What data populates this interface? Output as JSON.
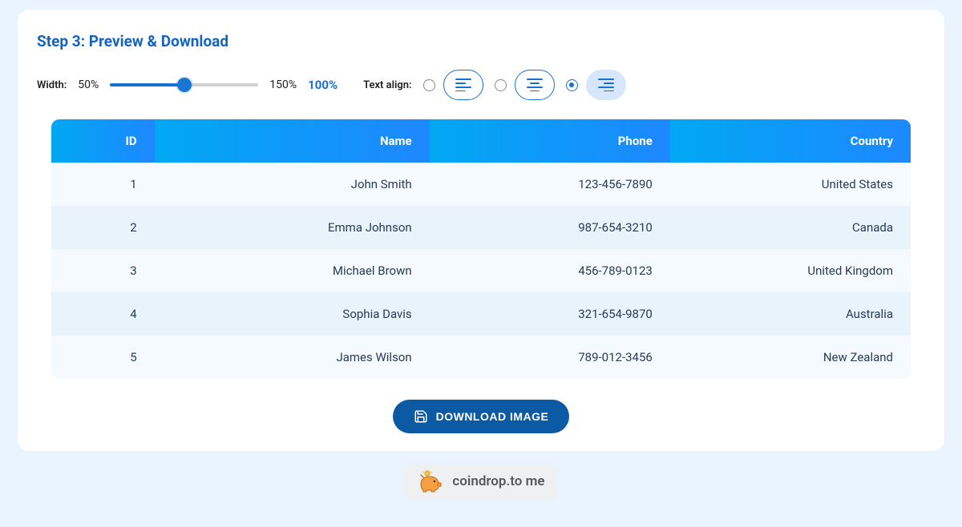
{
  "step_title": "Step 3: Preview & Download",
  "width_control": {
    "label": "Width:",
    "min_label": "50%",
    "max_label": "150%",
    "current_label": "100%",
    "percent_fill": 50
  },
  "text_align": {
    "label": "Text align:",
    "selected": "right",
    "options": [
      "left",
      "center",
      "right"
    ]
  },
  "table": {
    "headers": [
      "ID",
      "Name",
      "Phone",
      "Country"
    ],
    "rows": [
      [
        "1",
        "John Smith",
        "123-456-7890",
        "United States"
      ],
      [
        "2",
        "Emma Johnson",
        "987-654-3210",
        "Canada"
      ],
      [
        "3",
        "Michael Brown",
        "456-789-0123",
        "United Kingdom"
      ],
      [
        "4",
        "Sophia Davis",
        "321-654-9870",
        "Australia"
      ],
      [
        "5",
        "James Wilson",
        "789-012-3456",
        "New Zealand"
      ]
    ]
  },
  "download_button_label": "DOWNLOAD IMAGE",
  "coindrop_label": "coindrop.to me"
}
